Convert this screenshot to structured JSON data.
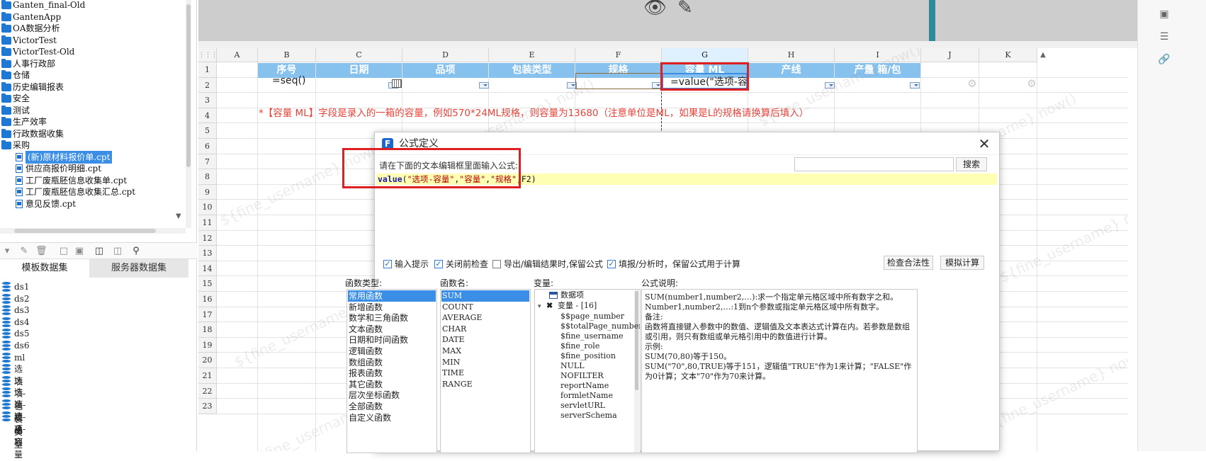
{
  "tree": {
    "items": [
      {
        "label": "Ganten_final-Old",
        "type": "folder"
      },
      {
        "label": "GantenApp",
        "type": "folder"
      },
      {
        "label": "OA数据分析",
        "type": "folder"
      },
      {
        "label": "VictorTest",
        "type": "folder"
      },
      {
        "label": "VictorTest-Old",
        "type": "folder"
      },
      {
        "label": "人事行政部",
        "type": "folder"
      },
      {
        "label": "仓储",
        "type": "folder"
      },
      {
        "label": "历史编辑报表",
        "type": "folder"
      },
      {
        "label": "安全",
        "type": "folder"
      },
      {
        "label": "测试",
        "type": "folder"
      },
      {
        "label": "生产效率",
        "type": "folder"
      },
      {
        "label": "行政数据收集",
        "type": "folder"
      },
      {
        "label": "采购",
        "type": "folder"
      },
      {
        "label": "(新)原材料报价单.cpt",
        "type": "file",
        "selected": true
      },
      {
        "label": "供应商报价明细.cpt",
        "type": "file"
      },
      {
        "label": "工厂废瓶胚信息收集单.cpt",
        "type": "file"
      },
      {
        "label": "工厂废瓶胚信息收集汇总.cpt",
        "type": "file"
      },
      {
        "label": "意见反馈.cpt",
        "type": "file"
      }
    ]
  },
  "data_tabs": {
    "template": "模板数据集",
    "server": "服务器数据集"
  },
  "datasets": [
    "ds1",
    "ds2",
    "ds3",
    "ds4",
    "ds5",
    "ds6",
    "ml",
    "选项",
    "选项-包装类型",
    "选项-规格",
    "选项-品项",
    "选项-容量"
  ],
  "sheet": {
    "columns": [
      "A",
      "B",
      "C",
      "D",
      "E",
      "F",
      "G",
      "H",
      "I",
      "J",
      "K"
    ],
    "rows": [
      "1",
      "2",
      "3",
      "4",
      "5",
      "6",
      "7",
      "8",
      "9",
      "10",
      "11",
      "12",
      "13",
      "14",
      "15",
      "16",
      "17",
      "18",
      "19",
      "20",
      "21",
      "22",
      "23"
    ],
    "headers": [
      "序号",
      "日期",
      "品项",
      "包装类型",
      "规格",
      "容量 ML",
      "产线",
      "产量 箱/包"
    ],
    "b2": "=seq()",
    "g2": "=value(\"选项-容",
    "note": "*【容量 ML】字段是录入的一箱的容量，例如570*24ML规格，则容量为13680（注意单位是ML，如果是L的规格请换算后填入）",
    "watermark": "${fine_username} now()"
  },
  "dialog": {
    "title": "公式定义",
    "prompt": "请在下面的文本编辑框里面输入公式:",
    "search_button": "搜索",
    "search_placeholder": "",
    "formula": {
      "fn": "value",
      "open": "(",
      "args": [
        "\"选项-容量\"",
        "\"容量\"",
        "\"规格\""
      ],
      "last": "F2",
      "close": ")"
    },
    "checks": [
      {
        "label": "输入提示",
        "checked": true
      },
      {
        "label": "关闭前检查",
        "checked": true
      },
      {
        "label": "导出/编辑结果时,保留公式",
        "checked": false
      },
      {
        "label": "填报/分析时，保留公式用于计算",
        "checked": true
      }
    ],
    "btn_check": "检查合法性",
    "btn_simulate": "模拟计算",
    "pane_titles": {
      "types": "函数类型:",
      "names": "函数名:",
      "vars": "变量:",
      "desc": "公式说明:"
    },
    "function_types": [
      "常用函数",
      "新增函数",
      "数学和三角函数",
      "文本函数",
      "日期和时间函数",
      "逻辑函数",
      "数组函数",
      "报表函数",
      "其它函数",
      "层次坐标函数",
      "全部函数",
      "自定义函数"
    ],
    "function_names": [
      "SUM",
      "COUNT",
      "AVERAGE",
      "CHAR",
      "DATE",
      "MAX",
      "MIN",
      "TIME",
      "RANGE"
    ],
    "variables": {
      "data_item": "数据项",
      "var_group": "变量 - [16]",
      "items": [
        "$$page_number",
        "$$totalPage_number",
        "$fine_username",
        "$fine_role",
        "$fine_position",
        "NULL",
        "NOFILTER",
        "reportName",
        "formletName",
        "servletURL",
        "serverSchema"
      ]
    },
    "description": [
      "SUM(number1,number2,…):求一个指定单元格区域中所有数字之和。",
      "Number1,number2,…:1到n个参数或指定单元格区域中所有数字。",
      "备注:",
      "函数将直接键入参数中的数值、逻辑值及文本表达式计算在内。若参数是数组或引用，则只有数组或单元格引用中的数值进行计算。",
      "示例:",
      "SUM(70,80)等于150。",
      "SUM(\"70\",80,TRUE)等于151，逻辑值\"TRUE\"作为1来计算；\"FALSE\"作为0计算；文本\"70\"作为70来计算。"
    ]
  },
  "colors": {
    "header_bg": "#87c1ee",
    "note": "#e8433a",
    "highlight": "#e02020",
    "selected": "#3b8ee6"
  }
}
